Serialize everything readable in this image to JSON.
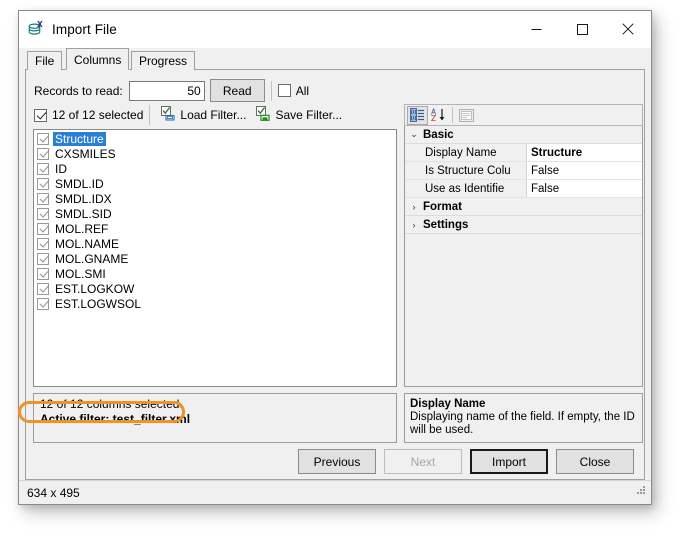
{
  "window": {
    "title": "Import File",
    "icon": "database-stack-x-icon",
    "controls": {
      "minimize": "—",
      "maximize": "□",
      "close": "✕"
    }
  },
  "tabs": [
    {
      "label": "File",
      "selected": false
    },
    {
      "label": "Columns",
      "selected": true
    },
    {
      "label": "Progress",
      "selected": false
    }
  ],
  "toolbar": {
    "records_label": "Records to read:",
    "records_value": "50",
    "records_placeholder": "",
    "read_label": "Read",
    "all_label": "All",
    "all_checked": false,
    "selected_count_label": "12 of 12 selected",
    "selected_count_checked": true,
    "load_filter_label": "Load Filter...",
    "save_filter_label": "Save Filter..."
  },
  "columns": [
    {
      "label": "Structure",
      "checked": true,
      "selected": true
    },
    {
      "label": "CXSMILES",
      "checked": true,
      "selected": false
    },
    {
      "label": "ID",
      "checked": true,
      "selected": false
    },
    {
      "label": "SMDL.ID",
      "checked": true,
      "selected": false
    },
    {
      "label": "SMDL.IDX",
      "checked": true,
      "selected": false
    },
    {
      "label": "SMDL.SID",
      "checked": true,
      "selected": false
    },
    {
      "label": "MOL.REF",
      "checked": true,
      "selected": false
    },
    {
      "label": "MOL.NAME",
      "checked": true,
      "selected": false
    },
    {
      "label": "MOL.GNAME",
      "checked": true,
      "selected": false
    },
    {
      "label": "MOL.SMI",
      "checked": true,
      "selected": false
    },
    {
      "label": "EST.LOGKOW",
      "checked": true,
      "selected": false
    },
    {
      "label": "EST.LOGWSOL",
      "checked": true,
      "selected": false
    }
  ],
  "status_panel": {
    "line1": "12 of 12 columns selected.",
    "line2": "Active filter: test_filter.xml",
    "highlight_color": "#f0912a"
  },
  "property_grid": {
    "toolbar": {
      "categorized": "categorized-view-icon",
      "alphabetical": "alphabetical-sort-icon",
      "property_pages": "property-pages-icon"
    },
    "rows": [
      {
        "kind": "category",
        "name": "Basic",
        "expanded": true,
        "glyph": "⌄"
      },
      {
        "kind": "property",
        "name": "Display Name",
        "value": "Structure",
        "selected": true
      },
      {
        "kind": "property",
        "name": "Is Structure Colu",
        "value": "False",
        "selected": false
      },
      {
        "kind": "property",
        "name": "Use as Identifie",
        "value": "False",
        "selected": false
      },
      {
        "kind": "category",
        "name": "Format",
        "expanded": false,
        "glyph": "›"
      },
      {
        "kind": "category",
        "name": "Settings",
        "expanded": false,
        "glyph": "›"
      }
    ]
  },
  "description": {
    "title": "Display Name",
    "text": "Displaying name of the field. If empty, the ID will be used."
  },
  "footer_buttons": [
    {
      "label": "Previous",
      "disabled": false,
      "default": false
    },
    {
      "label": "Next",
      "disabled": true,
      "default": false
    },
    {
      "label": "Import",
      "disabled": false,
      "default": true
    },
    {
      "label": "Close",
      "disabled": false,
      "default": false
    }
  ],
  "statusbar": {
    "text": "634 x 495"
  }
}
